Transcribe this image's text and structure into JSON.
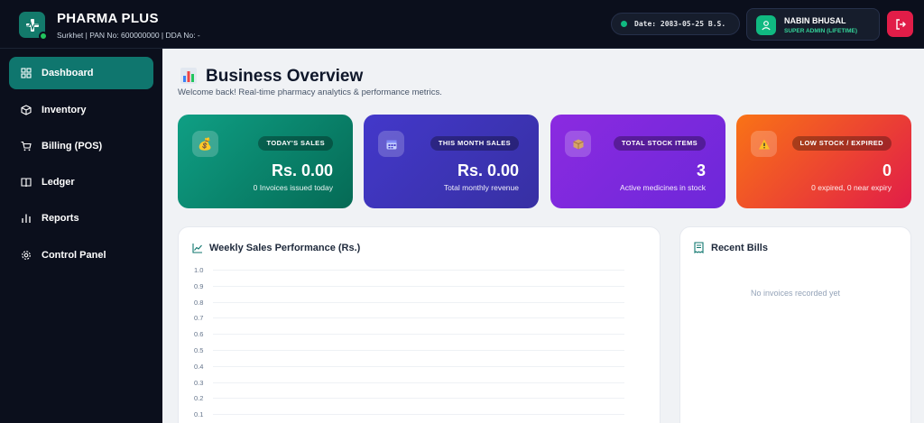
{
  "header": {
    "brand_name": "PHARMA PLUS",
    "brand_sub": "Surkhet | PAN No: 600000000 | DDA No: -",
    "date": "Date: 2083-05-25 B.S.",
    "user_name": "NABIN BHUSAL",
    "user_role": "SUPER ADMIN (LIFETIME)"
  },
  "sidebar": {
    "items": [
      {
        "label": "Dashboard",
        "icon": "grid-icon",
        "active": true
      },
      {
        "label": "Inventory",
        "icon": "box-icon"
      },
      {
        "label": "Billing (POS)",
        "icon": "cart-icon"
      },
      {
        "label": "Ledger",
        "icon": "book-icon"
      },
      {
        "label": "Reports",
        "icon": "bar-chart-icon"
      },
      {
        "label": "Control Panel",
        "icon": "gear-icon"
      }
    ]
  },
  "main": {
    "title": "Business Overview",
    "subtitle": "Welcome back! Real-time pharmacy analytics & performance metrics."
  },
  "stats": [
    {
      "tag": "TODAY'S SALES",
      "value": "Rs. 0.00",
      "note": "0 Invoices issued today",
      "icon": "money-bag-icon",
      "color_from": "#0f9f84",
      "color_to": "#056a55"
    },
    {
      "tag": "THIS MONTH SALES",
      "value": "Rs. 0.00",
      "note": "Total monthly revenue",
      "icon": "calendar-icon",
      "color_from": "#4338ca",
      "color_to": "#3730a3"
    },
    {
      "tag": "TOTAL STOCK ITEMS",
      "value": "3",
      "note": "Active medicines in stock",
      "icon": "package-icon",
      "color_from": "#8b2ae0",
      "color_to": "#6d28d9"
    },
    {
      "tag": "LOW STOCK / EXPIRED",
      "value": "0",
      "note": "0 expired, 0 near expiry",
      "icon": "warning-icon",
      "color_from": "#f97316",
      "color_to": "#e11d48"
    }
  ],
  "chart_panel": {
    "title": "Weekly Sales Performance (Rs.)",
    "y_ticks": [
      "1.0",
      "0.9",
      "0.8",
      "0.7",
      "0.6",
      "0.5",
      "0.4",
      "0.3",
      "0.2",
      "0.1"
    ]
  },
  "bills_panel": {
    "title": "Recent Bills",
    "empty_text": "No invoices recorded yet"
  },
  "chart_data": {
    "type": "line",
    "title": "Weekly Sales Performance (Rs.)",
    "ylim": [
      0,
      1.0
    ],
    "y_ticks": [
      1.0,
      0.9,
      0.8,
      0.7,
      0.6,
      0.5,
      0.4,
      0.3,
      0.2,
      0.1
    ],
    "series": [],
    "grid": true
  }
}
